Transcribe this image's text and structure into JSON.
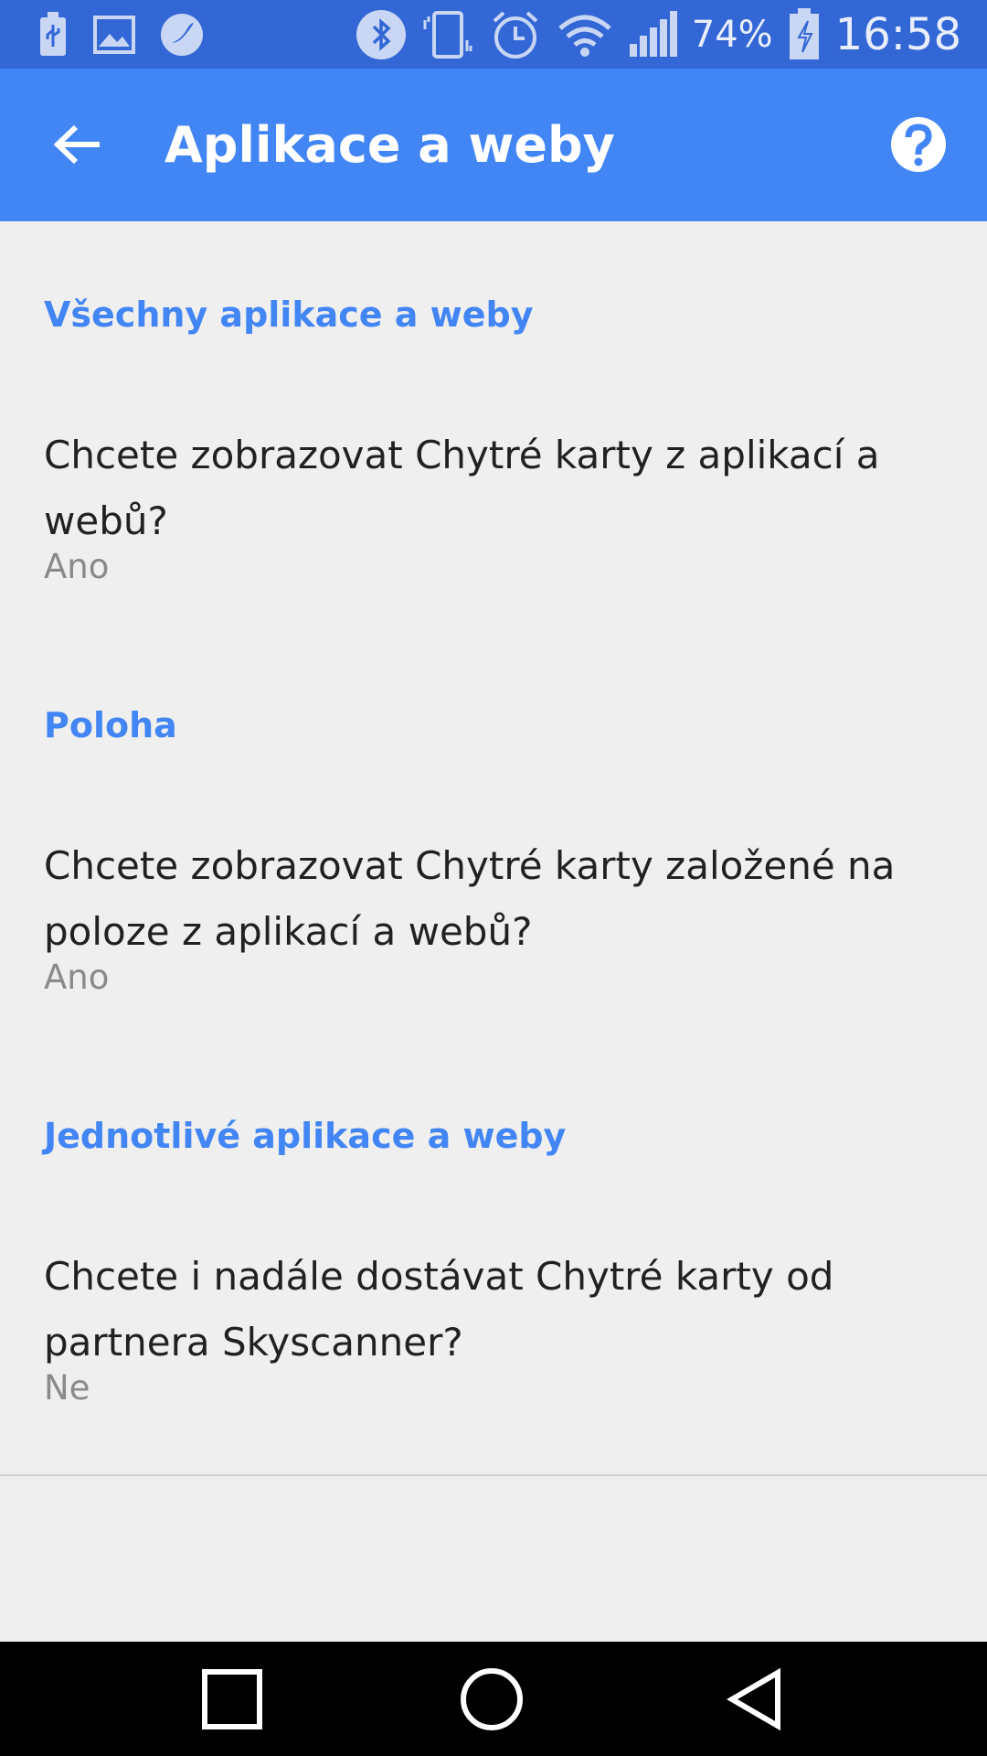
{
  "status_bar": {
    "icons_left": [
      "usb-icon",
      "image-icon",
      "s-voice-icon"
    ],
    "icons_right": [
      "bluetooth-icon",
      "vibrate-icon",
      "alarm-icon",
      "wifi-icon",
      "signal-icon"
    ],
    "battery_percent": "74%",
    "battery_icon": "battery-charging-icon",
    "time": "16:58"
  },
  "app_bar": {
    "title": "Aplikace a weby",
    "back_icon": "arrow-back-icon",
    "help_icon": "help-icon"
  },
  "sections": [
    {
      "header": "Všechny aplikace a weby",
      "item": {
        "title_line1": "Chcete zobrazovat Chytré karty z aplikací a",
        "title_line2": "webů?",
        "summary": "Ano"
      }
    },
    {
      "header": "Poloha",
      "item": {
        "title_line1": "Chcete zobrazovat Chytré karty založené na",
        "title_line2": "poloze z aplikací a webů?",
        "summary": "Ano"
      }
    },
    {
      "header": "Jednotlivé aplikace a weby",
      "item": {
        "title_line1": "Chcete i nadále dostávat Chytré karty od",
        "title_line2": "partnera Skyscanner?",
        "summary": "Ne"
      }
    }
  ],
  "nav_bar": {
    "buttons": [
      "recents-icon",
      "home-icon",
      "back-icon"
    ]
  },
  "colors": {
    "status_bar": "#3367d6",
    "app_bar": "#4285f4",
    "accent": "#4285f4",
    "background": "#efefef",
    "nav_bar": "#000000"
  }
}
